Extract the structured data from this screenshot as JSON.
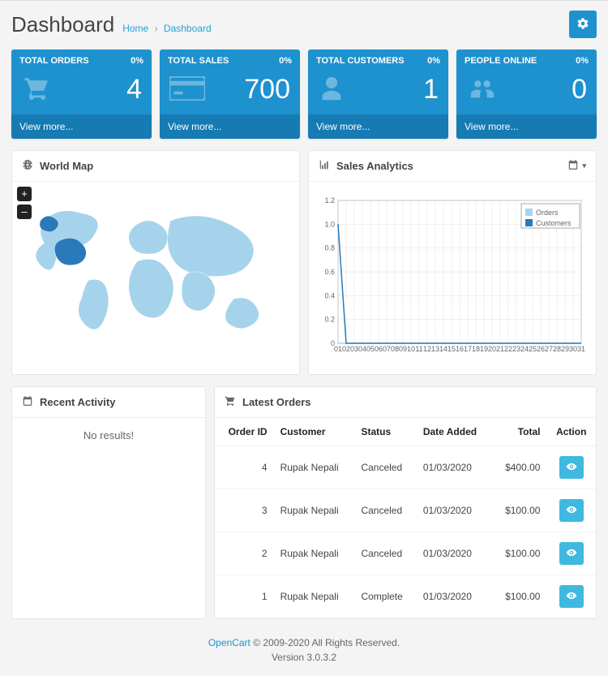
{
  "header": {
    "title": "Dashboard",
    "breadcrumb": {
      "home": "Home",
      "current": "Dashboard"
    }
  },
  "tiles": [
    {
      "label": "TOTAL ORDERS",
      "pct": "0%",
      "value": "4"
    },
    {
      "label": "TOTAL SALES",
      "pct": "0%",
      "value": "700"
    },
    {
      "label": "TOTAL CUSTOMERS",
      "pct": "0%",
      "value": "1"
    },
    {
      "label": "PEOPLE ONLINE",
      "pct": "0%",
      "value": "0"
    }
  ],
  "tile_footer": "View more...",
  "world_map": {
    "title": "World Map",
    "zoom_in": "+",
    "zoom_out": "–"
  },
  "sales_analytics": {
    "title": "Sales Analytics"
  },
  "chart_data": {
    "type": "line",
    "x_ticks": [
      "01",
      "02",
      "03",
      "04",
      "05",
      "06",
      "07",
      "08",
      "09",
      "10",
      "11",
      "12",
      "13",
      "14",
      "15",
      "16",
      "17",
      "18",
      "19",
      "20",
      "21",
      "22",
      "23",
      "24",
      "25",
      "26",
      "27",
      "28",
      "29",
      "30",
      "31"
    ],
    "y_ticks": [
      "0",
      "0.2",
      "0.4",
      "0.6",
      "0.8",
      "1.0",
      "1.2"
    ],
    "ylim": [
      0,
      1.2
    ],
    "series": [
      {
        "name": "Orders",
        "color": "#a6d3ec",
        "values": [
          0,
          0,
          0,
          0,
          0,
          0,
          0,
          0,
          0,
          0,
          0,
          0,
          0,
          0,
          0,
          0,
          0,
          0,
          0,
          0,
          0,
          0,
          0,
          0,
          0,
          0,
          0,
          0,
          0,
          0,
          0
        ]
      },
      {
        "name": "Customers",
        "color": "#2a7ab9",
        "values": [
          1,
          0,
          0,
          0,
          0,
          0,
          0,
          0,
          0,
          0,
          0,
          0,
          0,
          0,
          0,
          0,
          0,
          0,
          0,
          0,
          0,
          0,
          0,
          0,
          0,
          0,
          0,
          0,
          0,
          0,
          0
        ]
      }
    ],
    "legend": [
      "Orders",
      "Customers"
    ]
  },
  "recent_activity": {
    "title": "Recent Activity",
    "empty": "No results!"
  },
  "latest_orders": {
    "title": "Latest Orders",
    "columns": {
      "id": "Order ID",
      "customer": "Customer",
      "status": "Status",
      "date": "Date Added",
      "total": "Total",
      "action": "Action"
    },
    "rows": [
      {
        "id": "4",
        "customer": "Rupak Nepali",
        "status": "Canceled",
        "date": "01/03/2020",
        "total": "$400.00"
      },
      {
        "id": "3",
        "customer": "Rupak Nepali",
        "status": "Canceled",
        "date": "01/03/2020",
        "total": "$100.00"
      },
      {
        "id": "2",
        "customer": "Rupak Nepali",
        "status": "Canceled",
        "date": "01/03/2020",
        "total": "$100.00"
      },
      {
        "id": "1",
        "customer": "Rupak Nepali",
        "status": "Complete",
        "date": "01/03/2020",
        "total": "$100.00"
      }
    ]
  },
  "footer": {
    "brand": "OpenCart",
    "copy": " © 2009-2020 All Rights Reserved.",
    "version": "Version 3.0.3.2"
  }
}
